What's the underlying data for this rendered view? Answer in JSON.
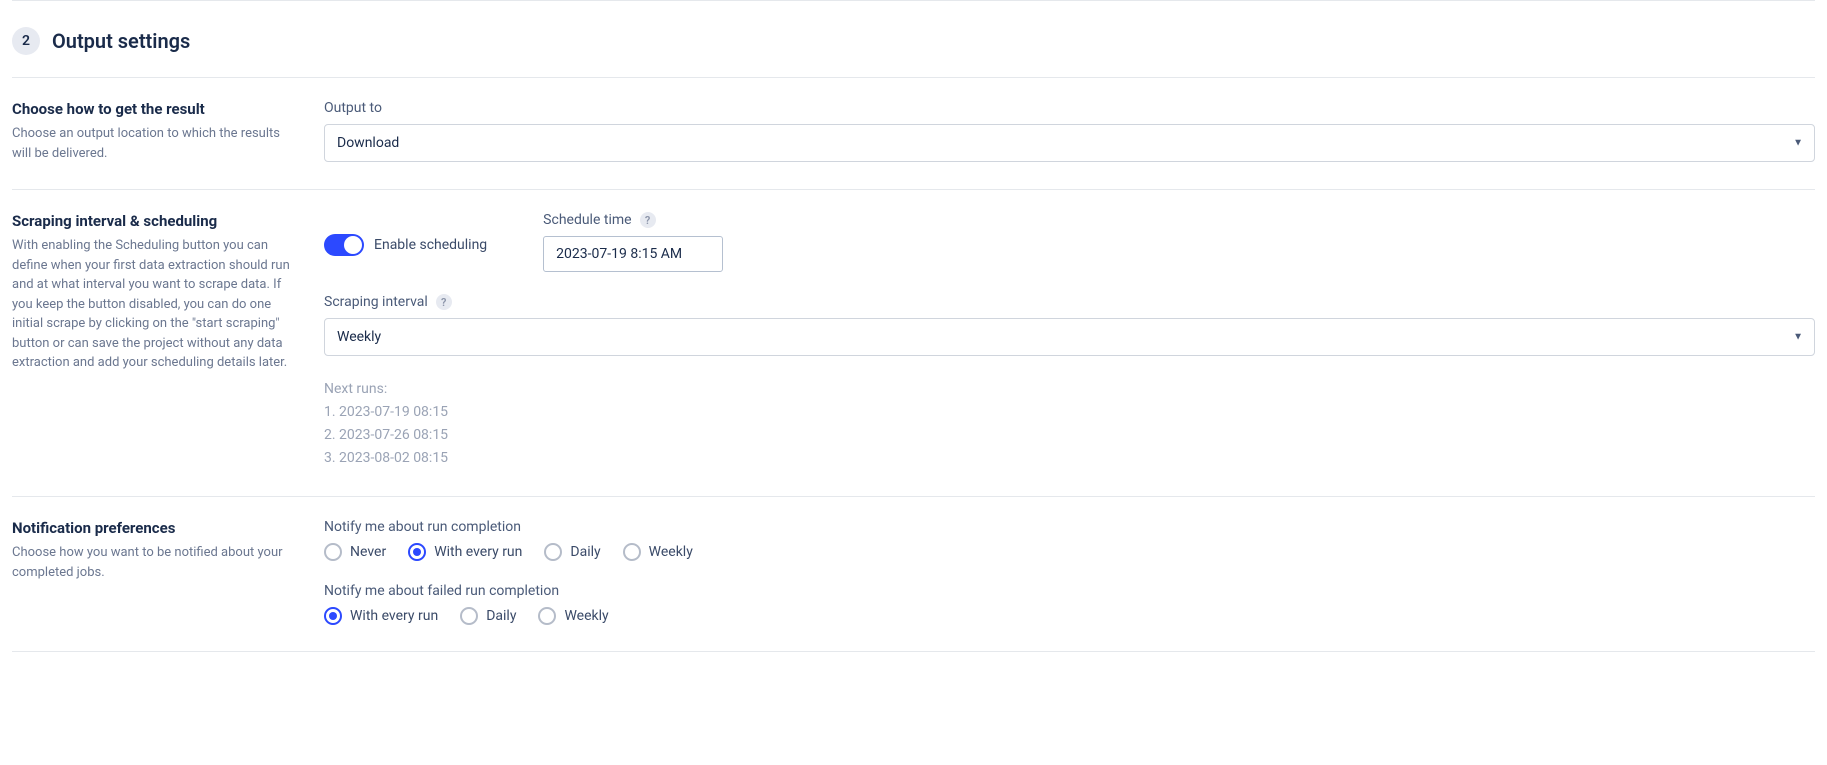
{
  "header": {
    "step_number": "2",
    "title": "Output settings"
  },
  "output": {
    "heading": "Choose how to get the result",
    "description": "Choose an output location to which the results will be delivered.",
    "field_label": "Output to",
    "value": "Download"
  },
  "scheduling": {
    "heading": "Scraping interval & scheduling",
    "description": "With enabling the Scheduling button you can define when your first data extraction should run and at what interval you want to scrape data. If you keep the button disabled, you can do one initial scrape by clicking on the \"start scraping\" button or can save the project without any data extraction and add your scheduling details later.",
    "enable_label": "Enable scheduling",
    "schedule_time_label": "Schedule time",
    "schedule_time_value": "2023-07-19 8:15 AM",
    "interval_label": "Scraping interval",
    "interval_value": "Weekly",
    "next_runs_label": "Next runs:",
    "next_runs": [
      "1.  2023-07-19 08:15",
      "2.  2023-07-26 08:15",
      "3.  2023-08-02 08:15"
    ]
  },
  "notifications": {
    "heading": "Notification preferences",
    "description": "Choose how you want to be notified about your completed jobs.",
    "completion_label": "Notify me about run completion",
    "completion_options": [
      {
        "label": "Never",
        "selected": false
      },
      {
        "label": "With every run",
        "selected": true
      },
      {
        "label": "Daily",
        "selected": false
      },
      {
        "label": "Weekly",
        "selected": false
      }
    ],
    "failed_label": "Notify me about failed run completion",
    "failed_options": [
      {
        "label": "With every run",
        "selected": true
      },
      {
        "label": "Daily",
        "selected": false
      },
      {
        "label": "Weekly",
        "selected": false
      }
    ]
  },
  "icons": {
    "help": "?"
  }
}
